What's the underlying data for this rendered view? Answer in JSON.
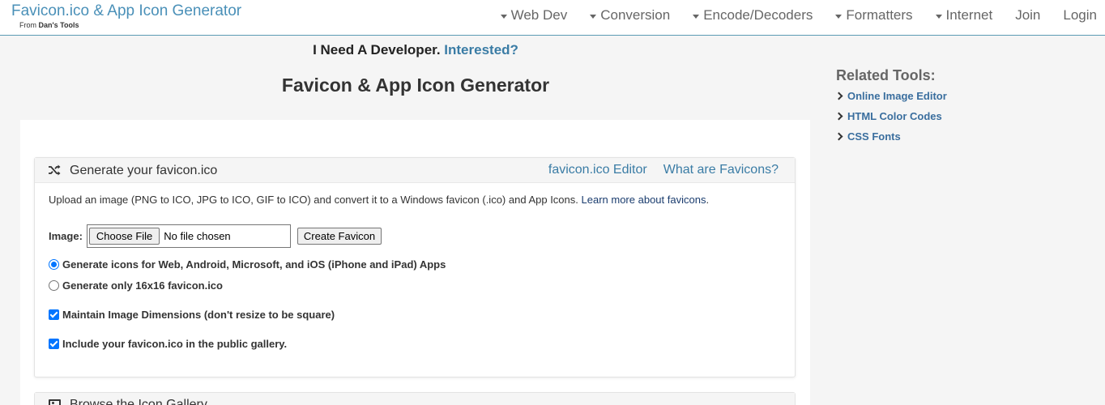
{
  "header": {
    "brand_title": "Favicon.ico & App Icon Generator",
    "brand_from": "From",
    "brand_source": "Dan's Tools",
    "nav": [
      {
        "label": "Web Dev",
        "dropdown": true
      },
      {
        "label": "Conversion",
        "dropdown": true
      },
      {
        "label": "Encode/Decoders",
        "dropdown": true
      },
      {
        "label": "Formatters",
        "dropdown": true
      },
      {
        "label": "Internet",
        "dropdown": true
      },
      {
        "label": "Join",
        "dropdown": false
      },
      {
        "label": "Login",
        "dropdown": false
      }
    ]
  },
  "promo": {
    "text": "I Need A Developer.",
    "link": "Interested?"
  },
  "page_title": "Favicon & App Icon Generator",
  "generator": {
    "icon": "shuffle-icon",
    "title": "Generate your favicon.ico",
    "links": [
      "favicon.ico Editor",
      "What are Favicons?"
    ],
    "intro": "Upload an image (PNG to ICO, JPG to ICO, GIF to ICO) and convert it to a Windows favicon (.ico) and App Icons.",
    "intro_link": "Learn more about favicons",
    "image_label": "Image:",
    "choose_file": "Choose File",
    "file_status": "No file chosen",
    "create_button": "Create Favicon",
    "options": {
      "radio_all": "Generate icons for Web, Android, Microsoft, and iOS (iPhone and iPad) Apps",
      "radio_16": "Generate only 16x16 favicon.ico",
      "check_dimensions": "Maintain Image Dimensions (don't resize to be square)",
      "check_gallery": "Include your favicon.ico in the public gallery."
    },
    "radio_selected": "radio_all",
    "accent_color": "#0075ff"
  },
  "gallery": {
    "icon": "image-icon",
    "title": "Browse the Icon Gallery"
  },
  "sidebar": {
    "title": "Related Tools:",
    "items": [
      "Online Image Editor",
      "HTML Color Codes",
      "CSS Fonts"
    ]
  }
}
